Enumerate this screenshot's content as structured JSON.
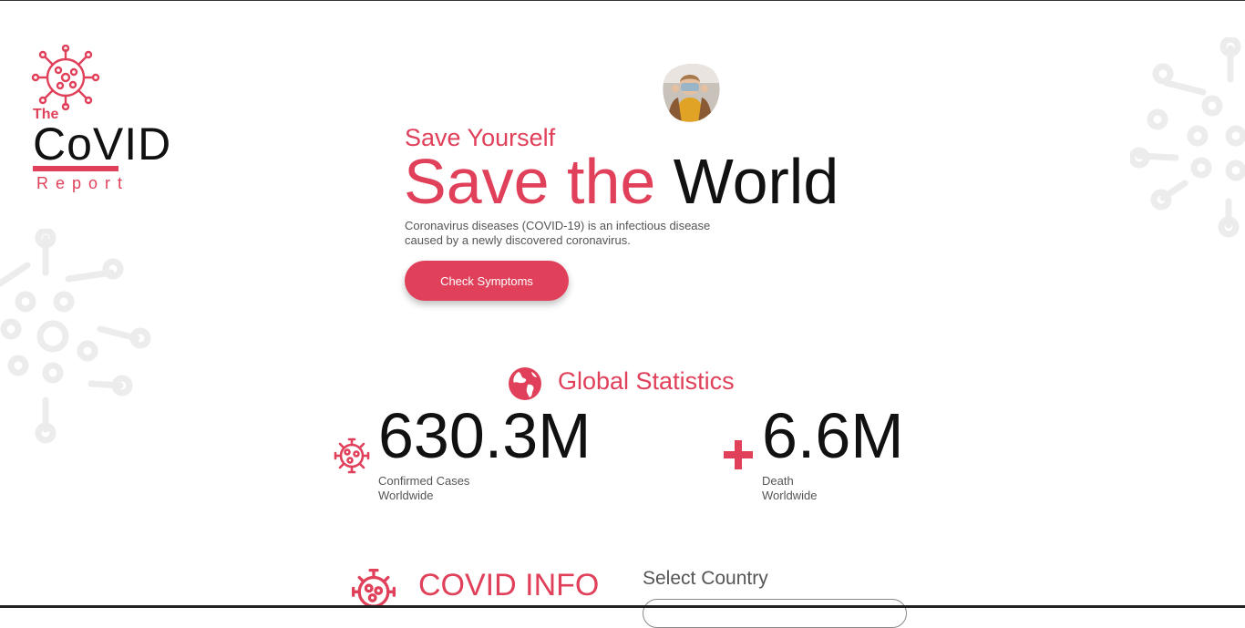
{
  "logo": {
    "the": "The",
    "name": "CoVID",
    "report": "Report"
  },
  "hero": {
    "subtitle": "Save Yourself",
    "title_part1": "Save the",
    "title_part2": "World",
    "description": "Coronavirus diseases (COVID-19) is an infectious disease caused by a newly discovered coronavirus.",
    "button_label": "Check Symptoms",
    "image_icon": "person-with-mask-image"
  },
  "stats": {
    "title": "Global Statistics",
    "confirmed": {
      "value": "630.3M",
      "label_line1": "Confirmed Cases",
      "label_line2": "Worldwide",
      "icon": "virus-icon"
    },
    "death": {
      "value": "6.6M",
      "label_line1": "Death",
      "label_line2": "Worldwide",
      "icon": "cross-icon"
    }
  },
  "info": {
    "title": "COVID INFO",
    "select_label": "Select Country",
    "icon": "virus-icon"
  },
  "colors": {
    "accent": "#e0405a",
    "text": "#111111",
    "muted": "#555555",
    "decor": "#ececec"
  }
}
